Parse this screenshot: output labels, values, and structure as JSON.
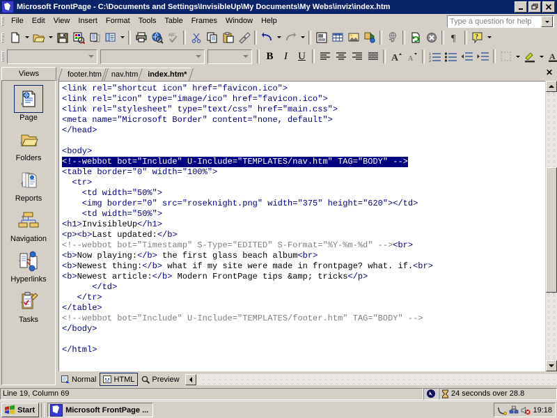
{
  "window": {
    "title": "Microsoft FrontPage - C:\\Documents and Settings\\InvisibleUp\\My Documents\\My Webs\\inviz\\index.htm",
    "icon": "frontpage-icon",
    "minimize_label": "_",
    "restore_label": "❐",
    "close_label": "✕"
  },
  "menubar": {
    "items": [
      {
        "label": "File"
      },
      {
        "label": "Edit"
      },
      {
        "label": "View"
      },
      {
        "label": "Insert"
      },
      {
        "label": "Format"
      },
      {
        "label": "Tools"
      },
      {
        "label": "Table"
      },
      {
        "label": "Frames"
      },
      {
        "label": "Window"
      },
      {
        "label": "Help"
      }
    ],
    "ask_placeholder": "Type a question for help"
  },
  "toolbar_standard": {
    "buttons": [
      {
        "name": "new-page-icon",
        "tooltip": "New"
      },
      {
        "name": "open-folder-icon",
        "tooltip": "Open"
      },
      {
        "name": "save-disk-icon",
        "tooltip": "Save"
      },
      {
        "name": "publish-web-icon",
        "tooltip": "Publish Web"
      },
      {
        "name": "folder-list-icon",
        "tooltip": "Toggle Folder List"
      },
      {
        "name": "navigation-pane-icon",
        "tooltip": "Navigation Pane"
      },
      {
        "name": "print-icon",
        "tooltip": "Print"
      },
      {
        "name": "preview-browser-icon",
        "tooltip": "Preview in Browser"
      },
      {
        "name": "spelling-icon",
        "tooltip": "Spelling"
      },
      {
        "name": "cut-scissors-icon",
        "tooltip": "Cut"
      },
      {
        "name": "copy-icon",
        "tooltip": "Copy"
      },
      {
        "name": "paste-clipboard-icon",
        "tooltip": "Paste"
      },
      {
        "name": "format-painter-icon",
        "tooltip": "Format Painter"
      },
      {
        "name": "undo-icon",
        "tooltip": "Undo"
      },
      {
        "name": "redo-icon",
        "tooltip": "Redo"
      },
      {
        "name": "insert-component-icon",
        "tooltip": "Insert Component"
      },
      {
        "name": "insert-table-icon",
        "tooltip": "Insert Table"
      },
      {
        "name": "insert-picture-icon",
        "tooltip": "Insert Picture From File"
      },
      {
        "name": "drawing-icon",
        "tooltip": "Drawing"
      },
      {
        "name": "hyperlink-icon",
        "tooltip": "Hyperlink"
      },
      {
        "name": "refresh-icon",
        "tooltip": "Refresh"
      },
      {
        "name": "stop-icon",
        "tooltip": "Stop"
      },
      {
        "name": "show-all-paragraph-icon",
        "tooltip": "Show All"
      },
      {
        "name": "help-question-icon",
        "tooltip": "Microsoft FrontPage Help"
      }
    ]
  },
  "toolbar_formatting": {
    "style_value": "",
    "font_value": "",
    "size_value": "",
    "buttons": [
      {
        "name": "bold-button",
        "label": "B"
      },
      {
        "name": "italic-button",
        "label": "I"
      },
      {
        "name": "underline-button",
        "label": "U"
      },
      {
        "name": "align-left-icon"
      },
      {
        "name": "align-center-icon"
      },
      {
        "name": "align-right-icon"
      },
      {
        "name": "justify-icon"
      },
      {
        "name": "increase-font-size-icon"
      },
      {
        "name": "decrease-font-size-icon"
      },
      {
        "name": "numbered-list-icon"
      },
      {
        "name": "bulleted-list-icon"
      },
      {
        "name": "decrease-indent-icon"
      },
      {
        "name": "increase-indent-icon"
      },
      {
        "name": "borders-icon"
      },
      {
        "name": "highlight-color-icon"
      },
      {
        "name": "font-color-icon"
      }
    ]
  },
  "views": {
    "header": "Views",
    "selected": "Page",
    "items": [
      {
        "label": "Page",
        "icon": "page-view-icon"
      },
      {
        "label": "Folders",
        "icon": "folders-view-icon"
      },
      {
        "label": "Reports",
        "icon": "reports-view-icon"
      },
      {
        "label": "Navigation",
        "icon": "navigation-view-icon"
      },
      {
        "label": "Hyperlinks",
        "icon": "hyperlinks-view-icon"
      },
      {
        "label": "Tasks",
        "icon": "tasks-view-icon"
      }
    ]
  },
  "doc_tabs": {
    "items": [
      {
        "label": "footer.htm",
        "active": false
      },
      {
        "label": "nav.htm",
        "active": false
      },
      {
        "label": "index.htm*",
        "active": true
      }
    ],
    "close_label": "✕"
  },
  "code": {
    "lines": [
      [
        {
          "t": "tag",
          "s": "<link rel=\"shortcut icon\" href=\"favicon.ico\">"
        }
      ],
      [
        {
          "t": "tag",
          "s": "<link rel=\"icon\" type=\"image/ico\" href=\"favicon.ico\">"
        }
      ],
      [
        {
          "t": "tag",
          "s": "<link rel=\"stylesheet\" type=\"text/css\" href=\"main.css\">"
        }
      ],
      [
        {
          "t": "tag",
          "s": "<meta name=\"Microsoft Border\" content=\"none, default\">"
        }
      ],
      [
        {
          "t": "tag",
          "s": "</head>"
        }
      ],
      [],
      [
        {
          "t": "tag",
          "s": "<body>"
        }
      ],
      [
        {
          "t": "hl",
          "s": "<!--webbot bot=\"Include\" U-Include=\"TEMPLATES/nav.htm\" TAG=\"BODY\" -->"
        }
      ],
      [
        {
          "t": "tag",
          "s": "<table border=\"0\" width=\"100%\">"
        }
      ],
      [
        {
          "t": "tag",
          "s": "  <tr>"
        }
      ],
      [
        {
          "t": "tag",
          "s": "    <td width=\"50%\">"
        }
      ],
      [
        {
          "t": "tag",
          "s": "    <img border=\"0\" src=\"roseknight.png\" width=\"375\" height=\"620\"></td>"
        }
      ],
      [
        {
          "t": "tag",
          "s": "    <td width=\"50%\">"
        }
      ],
      [
        {
          "t": "tag",
          "s": "<h1>"
        },
        {
          "t": "txt",
          "s": "InvisibleUp"
        },
        {
          "t": "tag",
          "s": "</h1>"
        }
      ],
      [
        {
          "t": "tag",
          "s": "<p><b>"
        },
        {
          "t": "txt",
          "s": "Last updated:"
        },
        {
          "t": "tag",
          "s": "</b>"
        }
      ],
      [
        {
          "t": "cmt",
          "s": "<!--webbot bot=\"Timestamp\" S-Type=\"EDITED\" S-Format=\"%Y-%m-%d\" -->"
        },
        {
          "t": "tag",
          "s": "<br>"
        }
      ],
      [
        {
          "t": "tag",
          "s": "<b>"
        },
        {
          "t": "txt",
          "s": "Now playing:"
        },
        {
          "t": "tag",
          "s": "</b>"
        },
        {
          "t": "txt",
          "s": " the first glass beach album"
        },
        {
          "t": "tag",
          "s": "<br>"
        }
      ],
      [
        {
          "t": "tag",
          "s": "<b>"
        },
        {
          "t": "txt",
          "s": "Newest thing:"
        },
        {
          "t": "tag",
          "s": "</b>"
        },
        {
          "t": "txt",
          "s": " what if my site were made in frontpage? what. if."
        },
        {
          "t": "tag",
          "s": "<br>"
        }
      ],
      [
        {
          "t": "tag",
          "s": "<b>"
        },
        {
          "t": "txt",
          "s": "Newest article:"
        },
        {
          "t": "tag",
          "s": "</b>"
        },
        {
          "t": "txt",
          "s": " Modern FrontPage tips &amp; tricks"
        },
        {
          "t": "tag",
          "s": "</p>"
        }
      ],
      [
        {
          "t": "tag",
          "s": "      </td>"
        }
      ],
      [
        {
          "t": "tag",
          "s": "   </tr>"
        }
      ],
      [
        {
          "t": "tag",
          "s": "</table>"
        }
      ],
      [
        {
          "t": "cmt",
          "s": "<!--webbot bot=\"Include\" U-Include=\"TEMPLATES/footer.htm\" TAG=\"BODY\" -->"
        }
      ],
      [
        {
          "t": "tag",
          "s": "</body>"
        }
      ],
      [],
      [
        {
          "t": "tag",
          "s": "</html>"
        }
      ]
    ]
  },
  "mode_tabs": {
    "items": [
      {
        "label": "Normal",
        "icon": "normal-view-icon",
        "selected": false
      },
      {
        "label": "HTML",
        "icon": "html-view-icon",
        "selected": true
      },
      {
        "label": "Preview",
        "icon": "preview-magnifier-icon",
        "selected": false
      }
    ]
  },
  "statusbar": {
    "position": "Line 19, Column 69",
    "connection_icon": "globe-cursor-icon",
    "timer_icon": "hourglass-icon",
    "estimate": "24 seconds over 28.8"
  },
  "taskbar": {
    "start_label": "Start",
    "start_icon": "windows-flag-icon",
    "tasks": [
      {
        "label": "Microsoft FrontPage ...",
        "icon": "frontpage-icon"
      }
    ],
    "tray_icons": [
      "dialup-icon",
      "network-icon",
      "volume-error-icon"
    ],
    "clock": "19:18"
  },
  "colors": {
    "titlebar": "#0a246a",
    "chrome": "#d4d0c8",
    "tag": "#000080",
    "comment": "#808080",
    "highlight_bg": "#000080"
  }
}
